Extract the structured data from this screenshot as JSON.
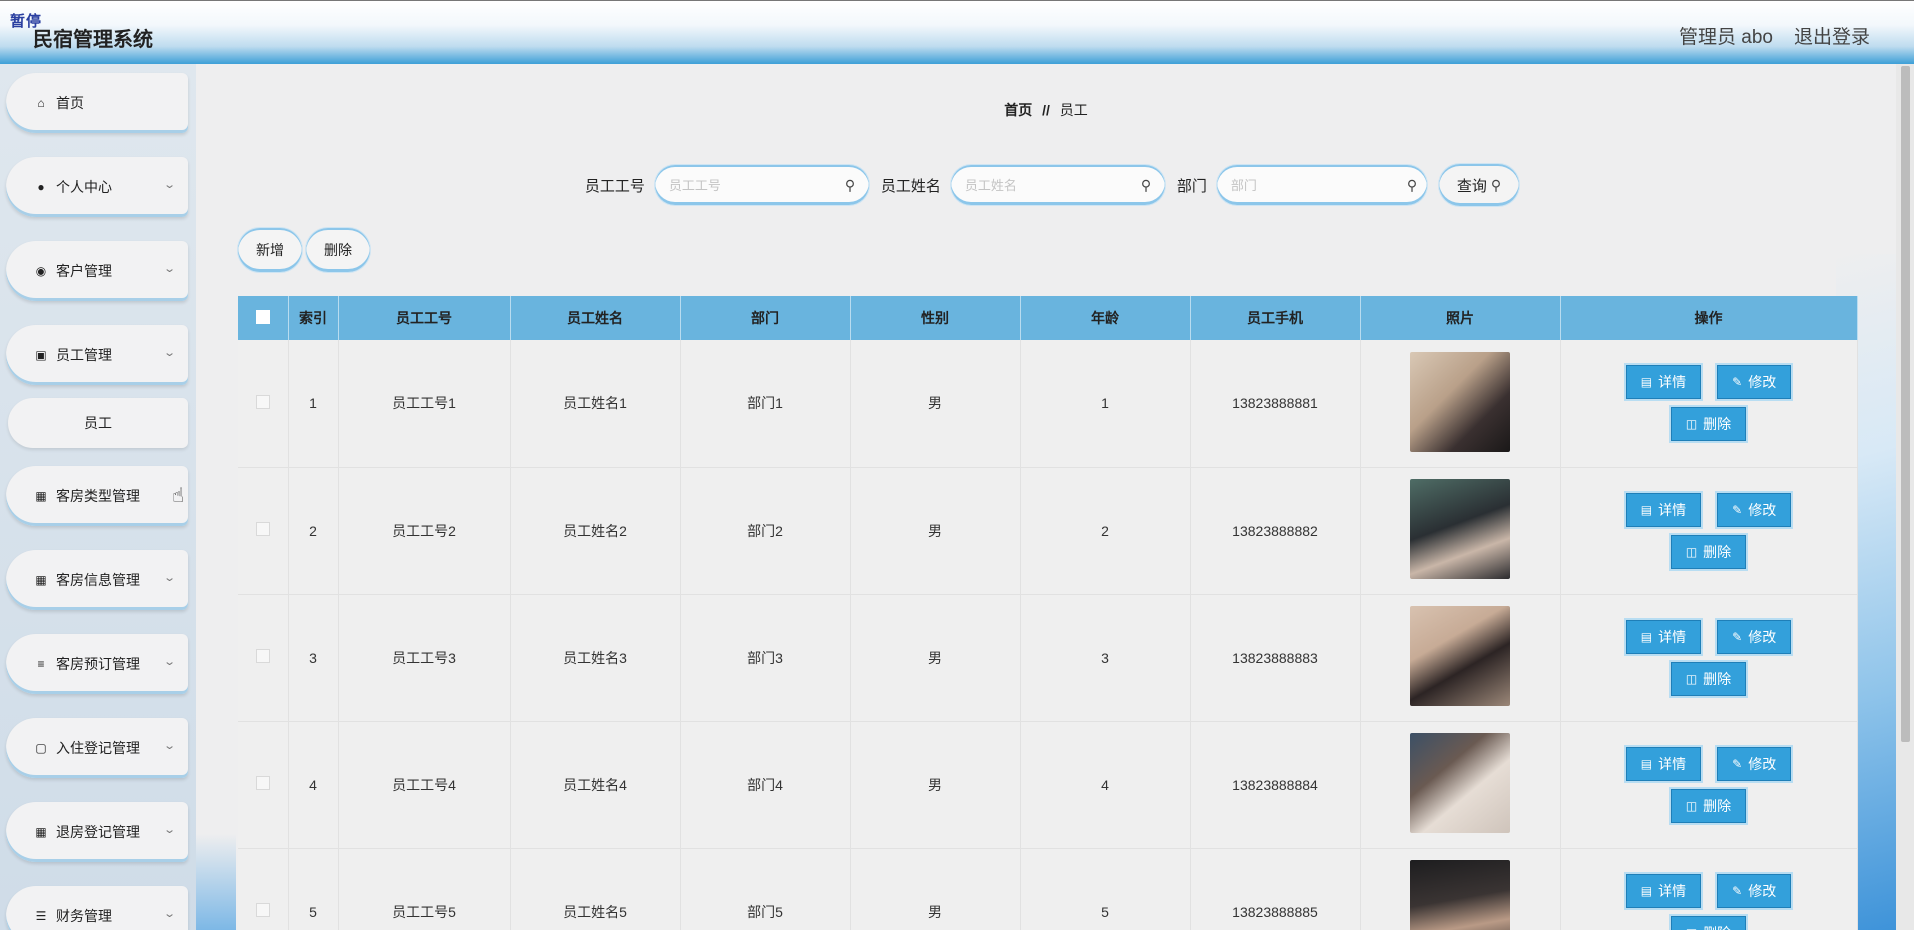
{
  "header": {
    "watermark": "暂停",
    "title": "民宿管理系统",
    "user": "管理员 abo",
    "logout": "退出登录"
  },
  "sidebar": {
    "items": [
      {
        "label": "首页",
        "icon": "home-icon"
      },
      {
        "label": "个人中心",
        "icon": "user-icon"
      },
      {
        "label": "客户管理",
        "icon": "location-icon"
      },
      {
        "label": "员工管理",
        "icon": "chat-icon"
      },
      {
        "label": "客房类型管理",
        "icon": "grid-icon"
      },
      {
        "label": "客房信息管理",
        "icon": "grid-icon"
      },
      {
        "label": "客房预订管理",
        "icon": "sliders-icon"
      },
      {
        "label": "入住登记管理",
        "icon": "briefcase-icon"
      },
      {
        "label": "退房登记管理",
        "icon": "grid-icon"
      },
      {
        "label": "财务管理",
        "icon": "menu-icon"
      }
    ],
    "sub_item": "员工"
  },
  "breadcrumb": {
    "home": "首页",
    "separator": "//",
    "current": "员工"
  },
  "search": {
    "emp_no_label": "员工工号",
    "emp_no_placeholder": "员工工号",
    "emp_name_label": "员工姓名",
    "emp_name_placeholder": "员工姓名",
    "dept_label": "部门",
    "dept_placeholder": "部门",
    "query_label": "查询"
  },
  "actions": {
    "add": "新增",
    "delete": "删除"
  },
  "table": {
    "headers": [
      "索引",
      "员工工号",
      "员工姓名",
      "部门",
      "性别",
      "年龄",
      "员工手机",
      "照片",
      "操作"
    ],
    "detail_label": "详情",
    "edit_label": "修改",
    "delete_label": "删除",
    "rows": [
      {
        "index": "1",
        "emp_no": "员工工号1",
        "name": "员工姓名1",
        "dept": "部门1",
        "gender": "男",
        "age": "1",
        "phone": "13823888881"
      },
      {
        "index": "2",
        "emp_no": "员工工号2",
        "name": "员工姓名2",
        "dept": "部门2",
        "gender": "男",
        "age": "2",
        "phone": "13823888882"
      },
      {
        "index": "3",
        "emp_no": "员工工号3",
        "name": "员工姓名3",
        "dept": "部门3",
        "gender": "男",
        "age": "3",
        "phone": "13823888883"
      },
      {
        "index": "4",
        "emp_no": "员工工号4",
        "name": "员工姓名4",
        "dept": "部门4",
        "gender": "男",
        "age": "4",
        "phone": "13823888884"
      },
      {
        "index": "5",
        "emp_no": "员工工号5",
        "name": "员工姓名5",
        "dept": "部门5",
        "gender": "男",
        "age": "5",
        "phone": "13823888885"
      }
    ]
  },
  "colors": {
    "accent": "#33a0db",
    "header_row": "#69b4de"
  }
}
